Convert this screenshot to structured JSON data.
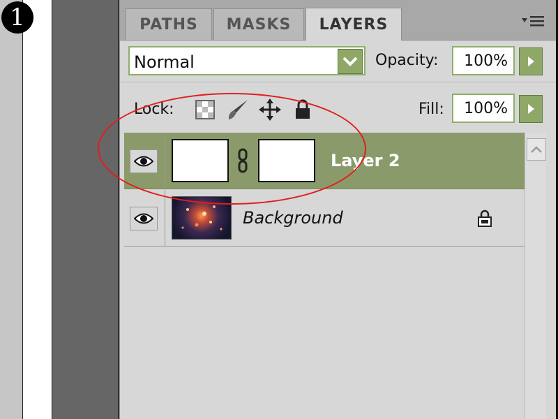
{
  "step": {
    "number": "1"
  },
  "panel": {
    "tabs": [
      {
        "label": "PATHS"
      },
      {
        "label": "MASKS"
      },
      {
        "label": "LAYERS"
      }
    ],
    "active_tab": "LAYERS",
    "menu_icon": "panel-menu-icon"
  },
  "blend": {
    "value": "Normal"
  },
  "opacity": {
    "label": "Opacity:",
    "value": "100%"
  },
  "lock": {
    "label": "Lock:",
    "icons": [
      "lock-transparent-pixels-icon",
      "lock-image-pixels-icon",
      "lock-position-icon",
      "lock-all-icon"
    ]
  },
  "fill": {
    "label": "Fill:",
    "value": "100%"
  },
  "layers": [
    {
      "name": "Layer 2",
      "visible": true,
      "selected": true,
      "has_mask": true
    },
    {
      "name": "Background",
      "visible": true,
      "selected": false,
      "locked": true
    }
  ],
  "colors": {
    "selected_row": "#8a9a6a",
    "accent": "#8fa868",
    "annotation": "#e01e1e"
  }
}
